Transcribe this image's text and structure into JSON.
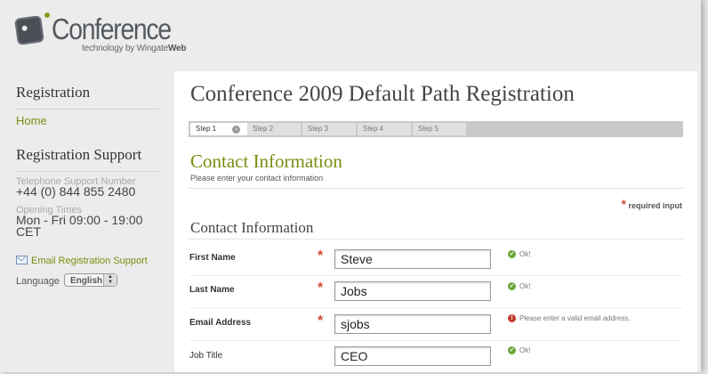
{
  "header": {
    "logo_text": "Conference",
    "tagline_prefix": "technology by Wingate",
    "tagline_brand": "Web"
  },
  "sidebar": {
    "registration_heading": "Registration",
    "home_link": "Home",
    "support_heading": "Registration Support",
    "telephone_label": "Telephone Support Number",
    "telephone_value": "+44 (0) 844 855 2480",
    "opening_label": "Opening Times",
    "opening_value": "Mon - Fri 09:00 - 19:00 CET",
    "email_link": "Email Registration Support",
    "language_label": "Language",
    "language_value": "English"
  },
  "main": {
    "page_title": "Conference 2009 Default Path Registration",
    "steps": [
      "Step 1",
      "Step 2",
      "Step 3",
      "Step 4",
      "Step 5"
    ],
    "step_arrow": "›",
    "section_title": "Contact Information",
    "section_subtitle": "Please enter your contact information",
    "required_star": "*",
    "required_note": "required input",
    "form_title": "Contact Information",
    "fields": [
      {
        "label": "First Name",
        "value": "Steve",
        "required": true,
        "status": "Ok!",
        "status_type": "ok"
      },
      {
        "label": "Last Name",
        "value": "Jobs",
        "required": true,
        "status": "Ok!",
        "status_type": "ok"
      },
      {
        "label": "Email Address",
        "value": "sjobs",
        "required": true,
        "status": "Please enter a valid email address.",
        "status_type": "error"
      },
      {
        "label": "Job Title",
        "value": "CEO",
        "required": false,
        "status": "Ok!",
        "status_type": "ok"
      }
    ]
  },
  "colors": {
    "accent_olive": "#7c8c10",
    "required_red": "#d24a3a",
    "ok_green": "#6aa63a",
    "error_red": "#c23a2a"
  }
}
